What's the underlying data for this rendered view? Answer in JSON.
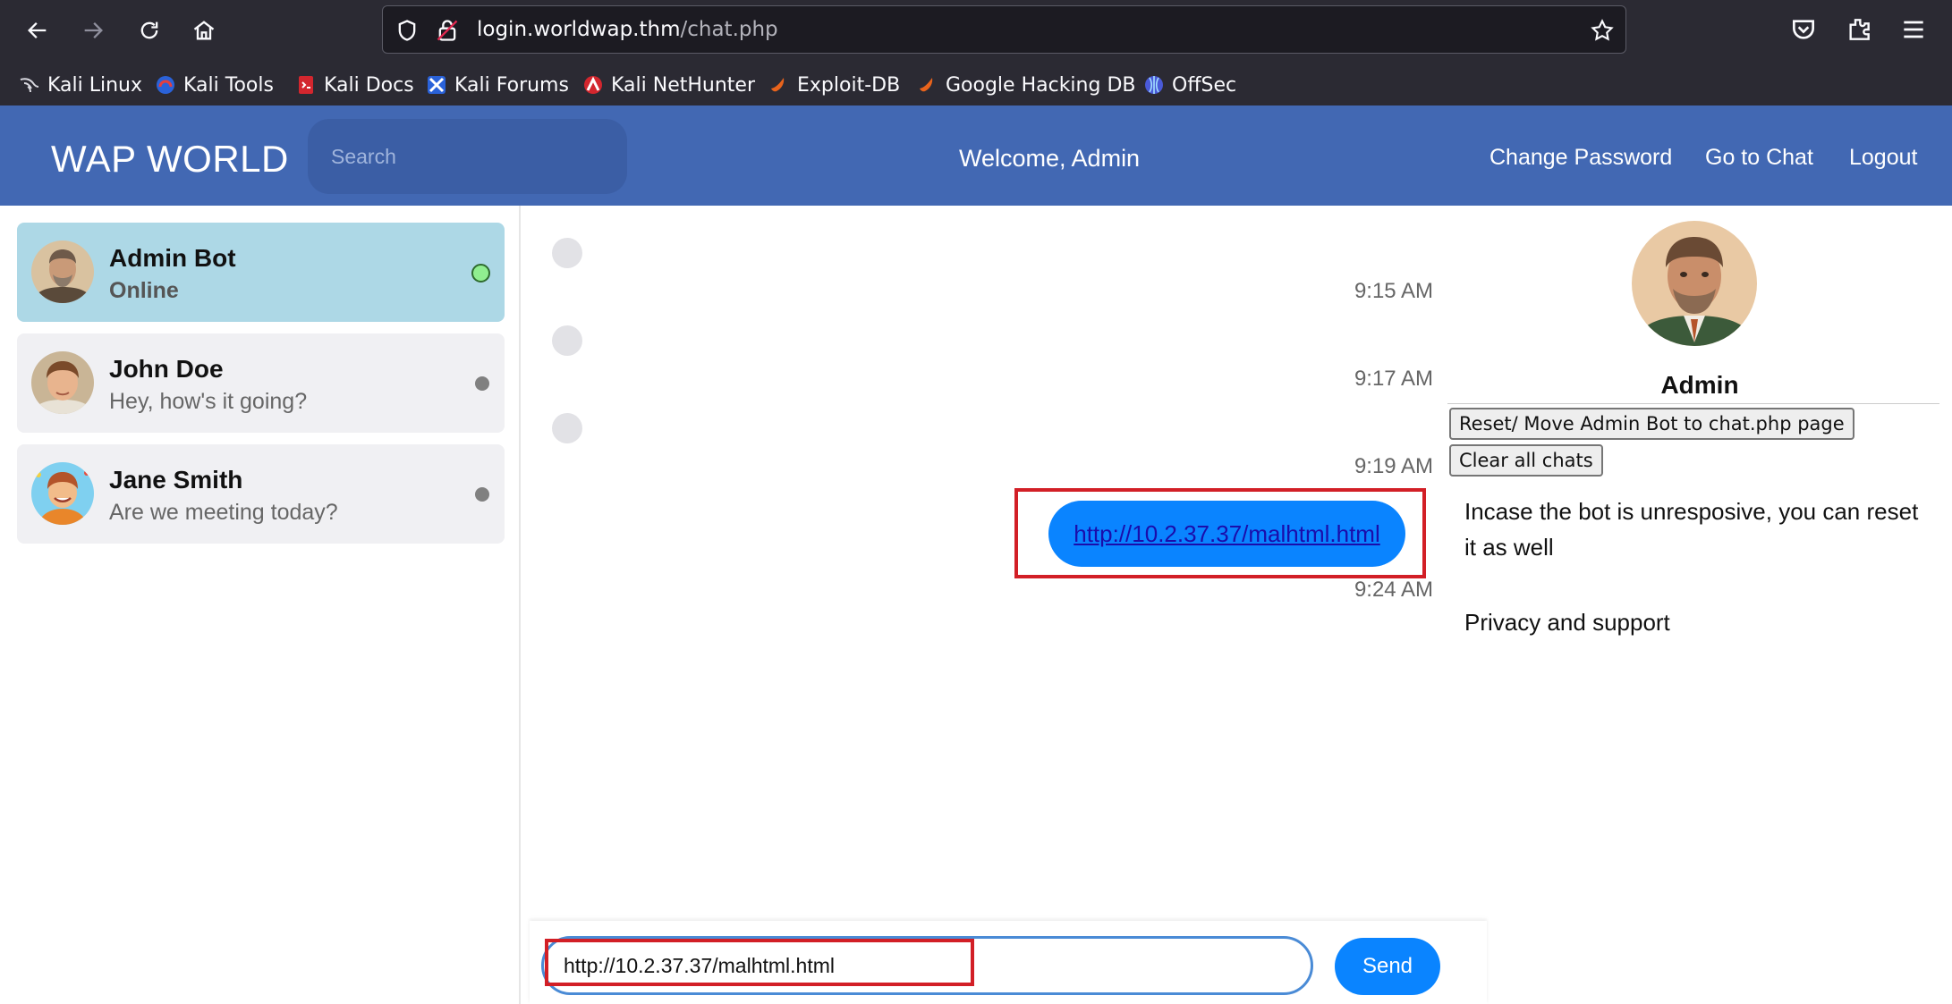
{
  "browser": {
    "url_domain": "login.worldwap.thm",
    "url_path": "/chat.php",
    "icons": [
      "back-icon",
      "forward-icon",
      "reload-icon",
      "home-icon",
      "shield-icon",
      "lock-icon",
      "star-icon",
      "pocket-icon",
      "extensions-icon",
      "menu-icon"
    ],
    "bookmarks": [
      {
        "label": "Kali Linux",
        "icon": "kali-dragon-icon"
      },
      {
        "label": "Kali Tools",
        "icon": "kali-tools-icon"
      },
      {
        "label": "Kali Docs",
        "icon": "kali-docs-icon"
      },
      {
        "label": "Kali Forums",
        "icon": "kali-forums-icon"
      },
      {
        "label": "Kali NetHunter",
        "icon": "kali-nethunter-icon"
      },
      {
        "label": "Exploit-DB",
        "icon": "exploit-db-icon"
      },
      {
        "label": "Google Hacking DB",
        "icon": "google-hacking-db-icon"
      },
      {
        "label": "OffSec",
        "icon": "offsec-icon"
      }
    ]
  },
  "header": {
    "brand": "WAP WORLD",
    "search_placeholder": "Search",
    "welcome": "Welcome, Admin",
    "links": [
      "Change Password",
      "Go to Chat",
      "Logout"
    ],
    "color": "#4268b3"
  },
  "contacts": [
    {
      "name": "Admin Bot",
      "message": "Online",
      "status": "online",
      "active": true
    },
    {
      "name": "John Doe",
      "message": "Hey, how's it going?",
      "status": "offline",
      "active": false
    },
    {
      "name": "Jane Smith",
      "message": "Are we meeting today?",
      "status": "offline",
      "active": false
    }
  ],
  "chat": {
    "messages": [
      {
        "text": "",
        "time": "9:15 AM"
      },
      {
        "text": "",
        "time": "9:17 AM"
      },
      {
        "text": "",
        "time": "9:19 AM"
      },
      {
        "text": "http://10.2.37.37/malhtml.html",
        "time": "9:24 AM",
        "is_link": true
      }
    ],
    "input_value": "http://10.2.37.37/malhtml.html",
    "send_label": "Send",
    "bubble_color": "#0a84ff",
    "highlight_color": "#d21f26"
  },
  "profile": {
    "name": "Admin",
    "buttons": [
      "Reset/ Move Admin Bot to chat.php page",
      "Clear all chats"
    ],
    "note": "Incase the bot is unresposive, you can reset it as well",
    "privacy": "Privacy and support"
  }
}
